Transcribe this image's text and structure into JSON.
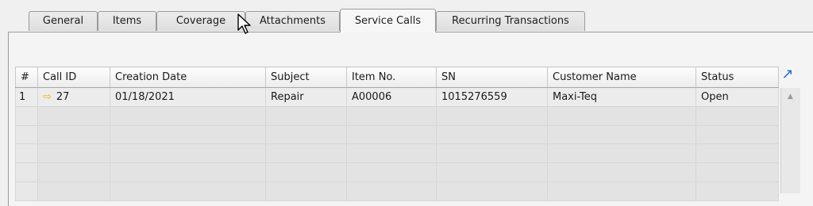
{
  "tabs": [
    {
      "label": "General",
      "active": false
    },
    {
      "label": "Items",
      "active": false
    },
    {
      "label": "Coverage",
      "active": false
    },
    {
      "label": "Attachments",
      "active": false
    },
    {
      "label": "Service Calls",
      "active": true
    },
    {
      "label": "Recurring Transactions",
      "active": false
    }
  ],
  "table": {
    "columns": [
      "#",
      "Call ID",
      "Creation Date",
      "Subject",
      "Item No.",
      "SN",
      "Customer Name",
      "Status"
    ],
    "rows": [
      {
        "num": "1",
        "call_id": "27",
        "creation_date": "01/18/2021",
        "subject": "Repair",
        "item_no": "A00006",
        "sn": "1015276559",
        "customer_name": "Maxi-Teq",
        "status": "Open"
      }
    ]
  },
  "icons": {
    "link_arrow": "link-arrow-icon",
    "expand": "expand-icon",
    "scroll_up": "scroll-up-icon",
    "cursor": "mouse-cursor-icon"
  },
  "colors": {
    "link_arrow": "#f0b400",
    "expand": "#2c6fce"
  }
}
